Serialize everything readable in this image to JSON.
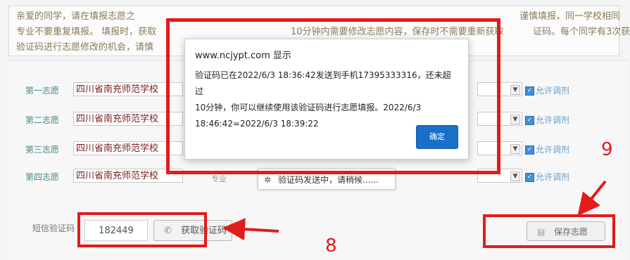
{
  "notice": {
    "line1_left": "亲爱的同学，请在填报志愿之",
    "line1_right": "谨慎填报，同一学校相同",
    "line2_left": "专业不要重复填报。  填报时，获取",
    "line2_mid": "10分钟内需要修改志愿内容，保存时不需要重新获取",
    "line2_right": "证码。每个同学有3次获取",
    "line3": "验证码进行志愿修改的机会，请慎"
  },
  "rows": [
    {
      "label": "第一志愿",
      "school": "四川省南充师范学校",
      "allow": "允许调剂"
    },
    {
      "label": "第二志愿",
      "school": "四川省南充师范学校",
      "allow": "允许调剂"
    },
    {
      "label": "第三志愿",
      "school": "四川省南充师范学校",
      "allow": "允许调剂"
    },
    {
      "label": "第四志愿",
      "school": "四川省南充师范学校",
      "allow": "允许调剂"
    }
  ],
  "row4_extra": "专业",
  "sms": {
    "label": "短信验证码",
    "code_value": "182449",
    "get_code_label": "获取验证码"
  },
  "save": {
    "label": "保存志愿"
  },
  "toast": {
    "text": "验证码发送中，请稍候......"
  },
  "dialog": {
    "title": "www.ncjypt.com 显示",
    "message_lines": [
      "验证码已在2022/6/3 18:36:42发送到手机17395333316，还未超过",
      "10分钟，你可以继续使用该验证码进行志愿填报。2022/6/3",
      "18:46:42=2022/6/3 18:39:22"
    ],
    "ok_label": "确定"
  },
  "annotations": {
    "step8": "8",
    "step9": "9"
  },
  "colors": {
    "highlight": "#e21b1b",
    "primary_button": "#1a6fc9"
  },
  "icons": {
    "checkbox": "check-icon",
    "get_code": "phone-icon",
    "save": "save-icon",
    "spinner": "spinner-icon"
  }
}
